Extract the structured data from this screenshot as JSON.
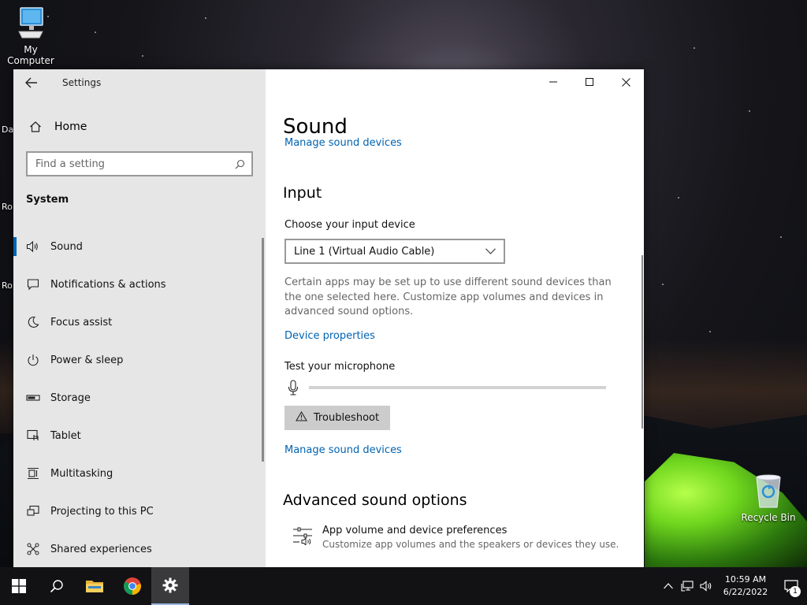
{
  "desktop": {
    "icons": [
      {
        "label": "My Computer"
      },
      {
        "label": "Recycle Bin"
      }
    ],
    "edge_labels": [
      "Da",
      "Ro",
      "Ro"
    ]
  },
  "window": {
    "app_title": "Settings",
    "sidebar": {
      "home_label": "Home",
      "search_placeholder": "Find a setting",
      "section": "System",
      "items": [
        {
          "label": "Sound",
          "icon": "speaker-icon",
          "active": true
        },
        {
          "label": "Notifications & actions",
          "icon": "notification-icon"
        },
        {
          "label": "Focus assist",
          "icon": "moon-icon"
        },
        {
          "label": "Power & sleep",
          "icon": "power-icon"
        },
        {
          "label": "Storage",
          "icon": "storage-icon"
        },
        {
          "label": "Tablet",
          "icon": "tablet-icon"
        },
        {
          "label": "Multitasking",
          "icon": "multitasking-icon"
        },
        {
          "label": "Projecting to this PC",
          "icon": "projecting-icon"
        },
        {
          "label": "Shared experiences",
          "icon": "shared-experiences-icon"
        }
      ]
    },
    "main": {
      "title": "Sound",
      "cut_off_link": "Manage sound devices",
      "input_heading": "Input",
      "choose_input_label": "Choose your input device",
      "input_device_value": "Line 1 (Virtual Audio Cable)",
      "description": "Certain apps may be set up to use different sound devices than the one selected here. Customize app volumes and devices in advanced sound options.",
      "device_properties_link": "Device properties",
      "test_mic_label": "Test your microphone",
      "mic_level": 0,
      "troubleshoot_label": "Troubleshoot",
      "manage_devices_link": "Manage sound devices",
      "advanced_heading": "Advanced sound options",
      "app_volume_title": "App volume and device preferences",
      "app_volume_subtitle": "Customize app volumes and the speakers or devices they use."
    }
  },
  "taskbar": {
    "items": [
      "start-icon",
      "search-icon",
      "file-explorer-icon",
      "chrome-icon",
      "settings-icon"
    ],
    "time": "10:59 AM",
    "date": "6/22/2022",
    "notification_count": "1"
  },
  "colors": {
    "accent": "#0063b1",
    "sidebar_bg": "#e6e6e6",
    "taskbar_bg": "#121214"
  }
}
